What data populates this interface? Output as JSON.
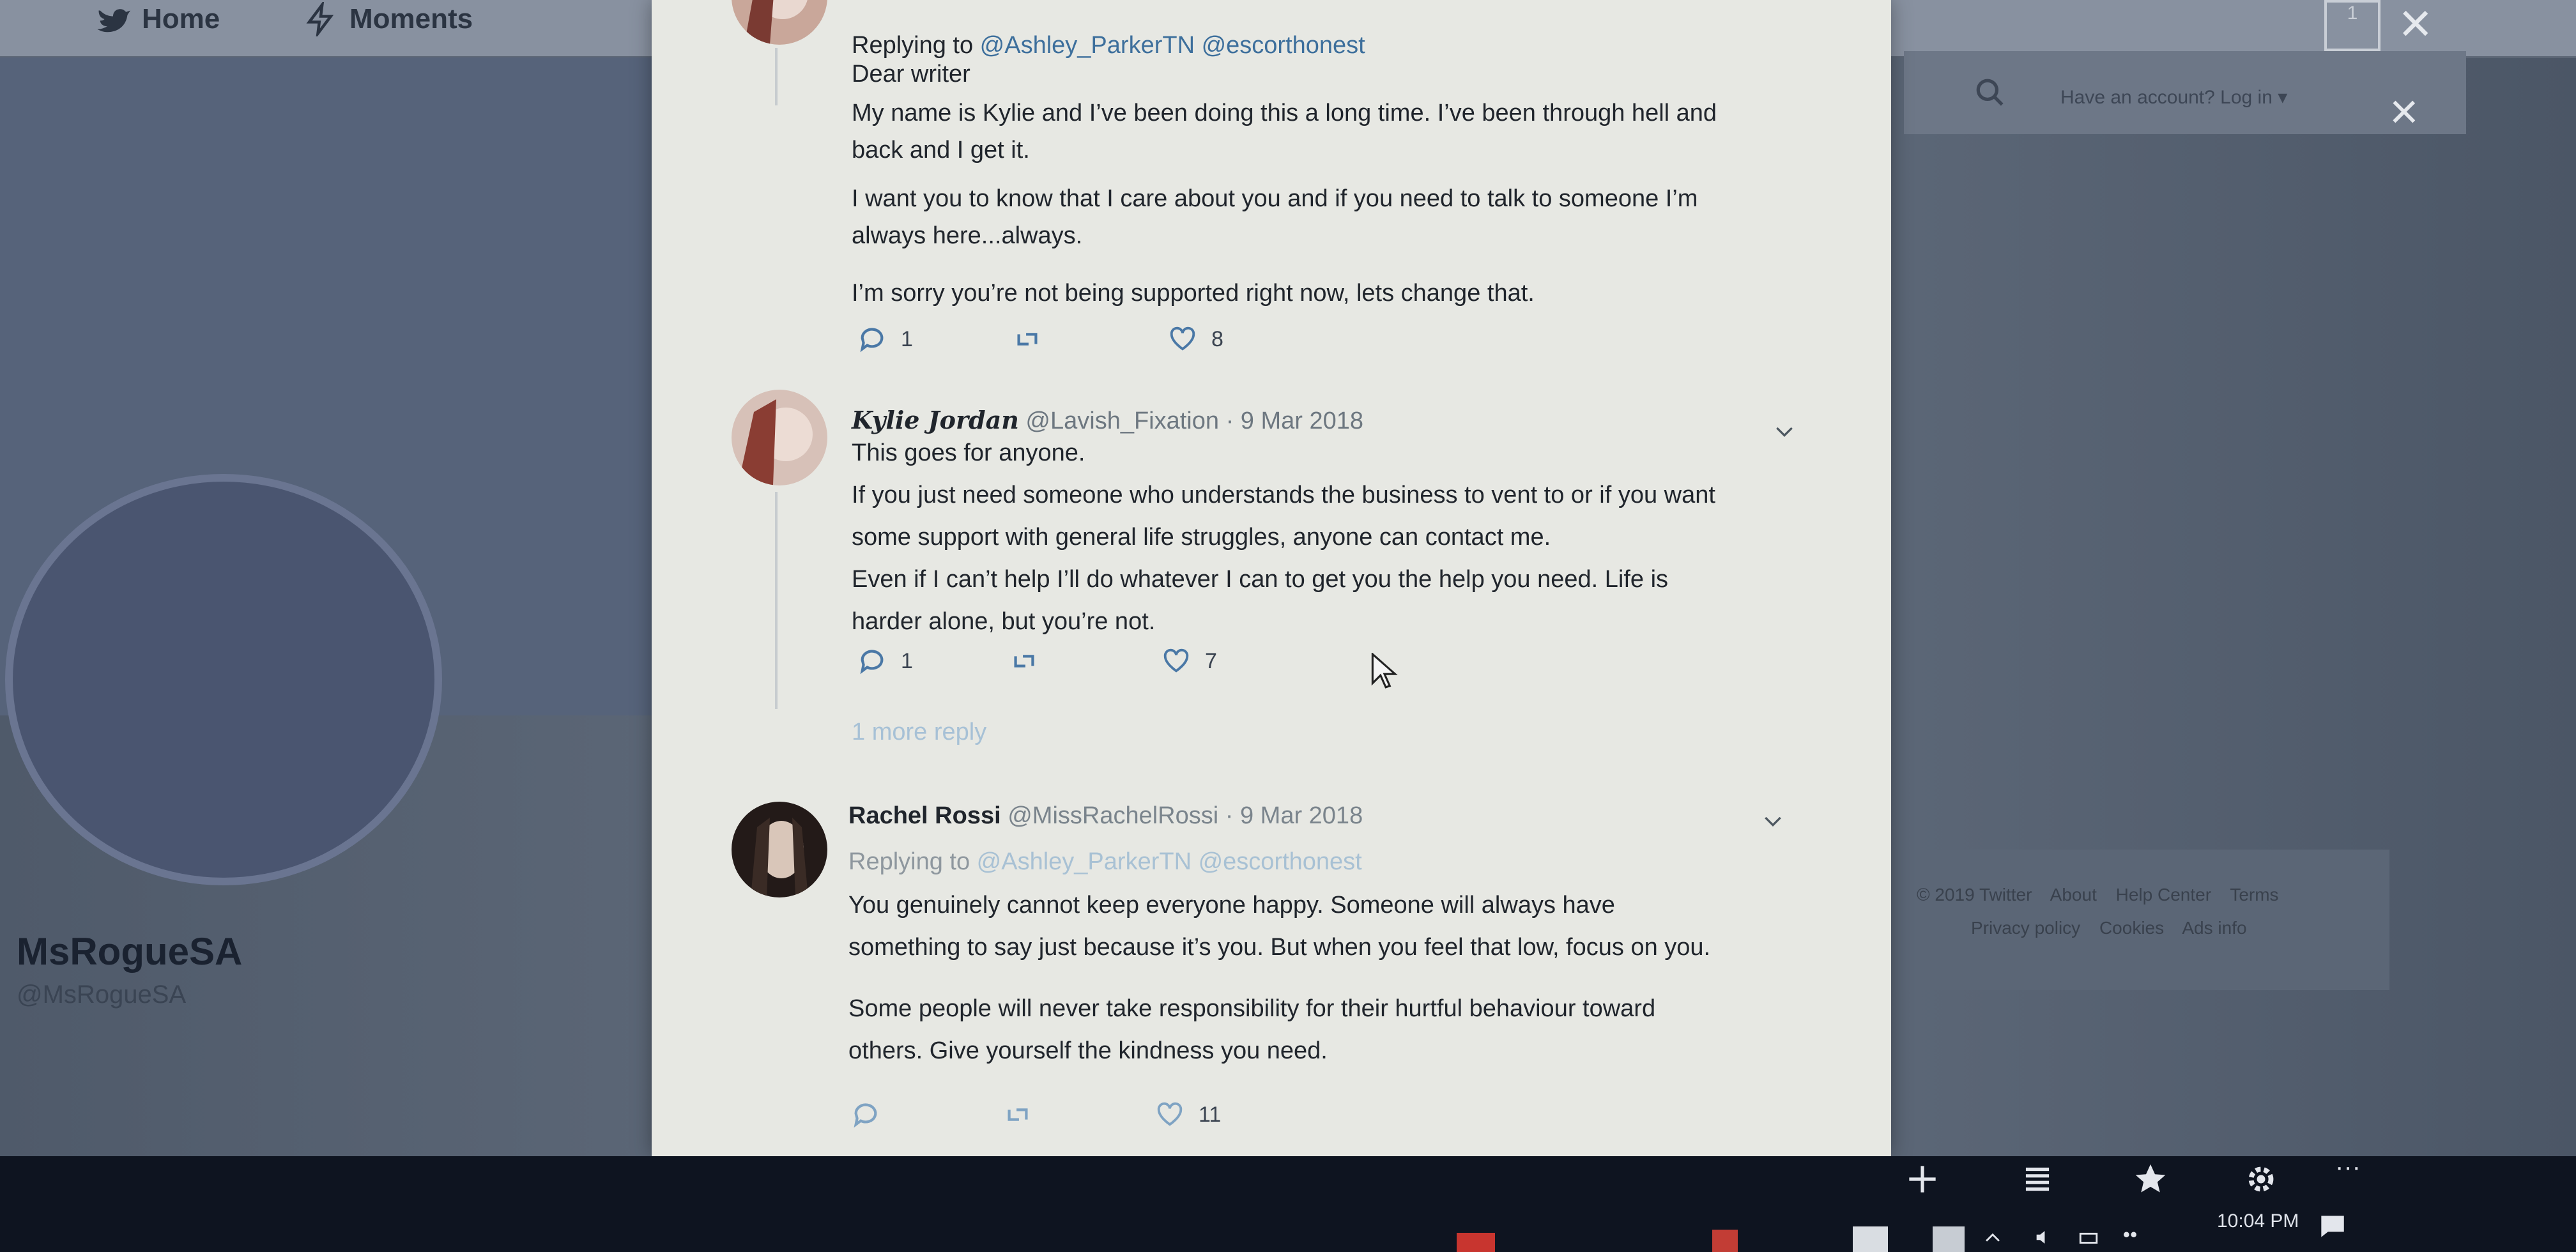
{
  "nav": {
    "home": "Home",
    "moments": "Moments"
  },
  "topbar": {
    "login_text": "Have an account? Log in ▾",
    "tab_count": "1"
  },
  "profile": {
    "name": "MsRogueSA",
    "handle": "@MsRogueSA"
  },
  "footer": {
    "line1": [
      "© 2019 Twitter",
      "About",
      "Help Center",
      "Terms"
    ],
    "line2": [
      "Privacy policy",
      "Cookies",
      "Ads info"
    ]
  },
  "tweets": {
    "first": {
      "replying_prefix": "Replying to ",
      "replying_handles": "@Ashley_ParkerTN @escorthonest",
      "lines": [
        "Dear writer",
        "My name is Kylie and I’ve been doing this a long time. I’ve been through hell and",
        "back and I get it.",
        "I want you to know that I care about you and if you need to talk to someone I’m",
        "always here...always.",
        "I’m sorry you’re not being supported right now, lets change that."
      ],
      "replies": "1",
      "likes": "8"
    },
    "second": {
      "name": "Kylie Jordan",
      "handle": "@Lavish_Fixation",
      "date": "· 9 Mar 2018",
      "lines": [
        "This goes for anyone.",
        "If you just need someone who understands the business to vent to or if you want",
        "some support with general life struggles, anyone can contact me.",
        "Even if I can’t help I’ll do whatever I can to get you the help you need. Life is",
        "harder alone, but you’re not."
      ],
      "replies": "1",
      "likes": "7"
    },
    "more_reply": "1 more reply",
    "third": {
      "name": "Rachel Rossi",
      "handle": "@MissRachelRossi",
      "date": "· 9 Mar 2018",
      "replying_prefix": "Replying to ",
      "replying_handles": "@Ashley_ParkerTN @escorthonest",
      "lines": [
        "You genuinely cannot keep everyone happy. Someone will always have",
        "something to say just because it’s you. But when you feel that low, focus on you.",
        "",
        "Some people will never take responsibility for their hurtful behaviour toward",
        "others. Give yourself the kindness you need."
      ],
      "likes": "11"
    }
  },
  "taskbar": {
    "time": "10:04 PM"
  },
  "colors": {
    "modal_bg": "#e7e8e3",
    "link": "#3d6f9c",
    "like_outline": "#3a4350",
    "page_bg": "#5d6878"
  }
}
